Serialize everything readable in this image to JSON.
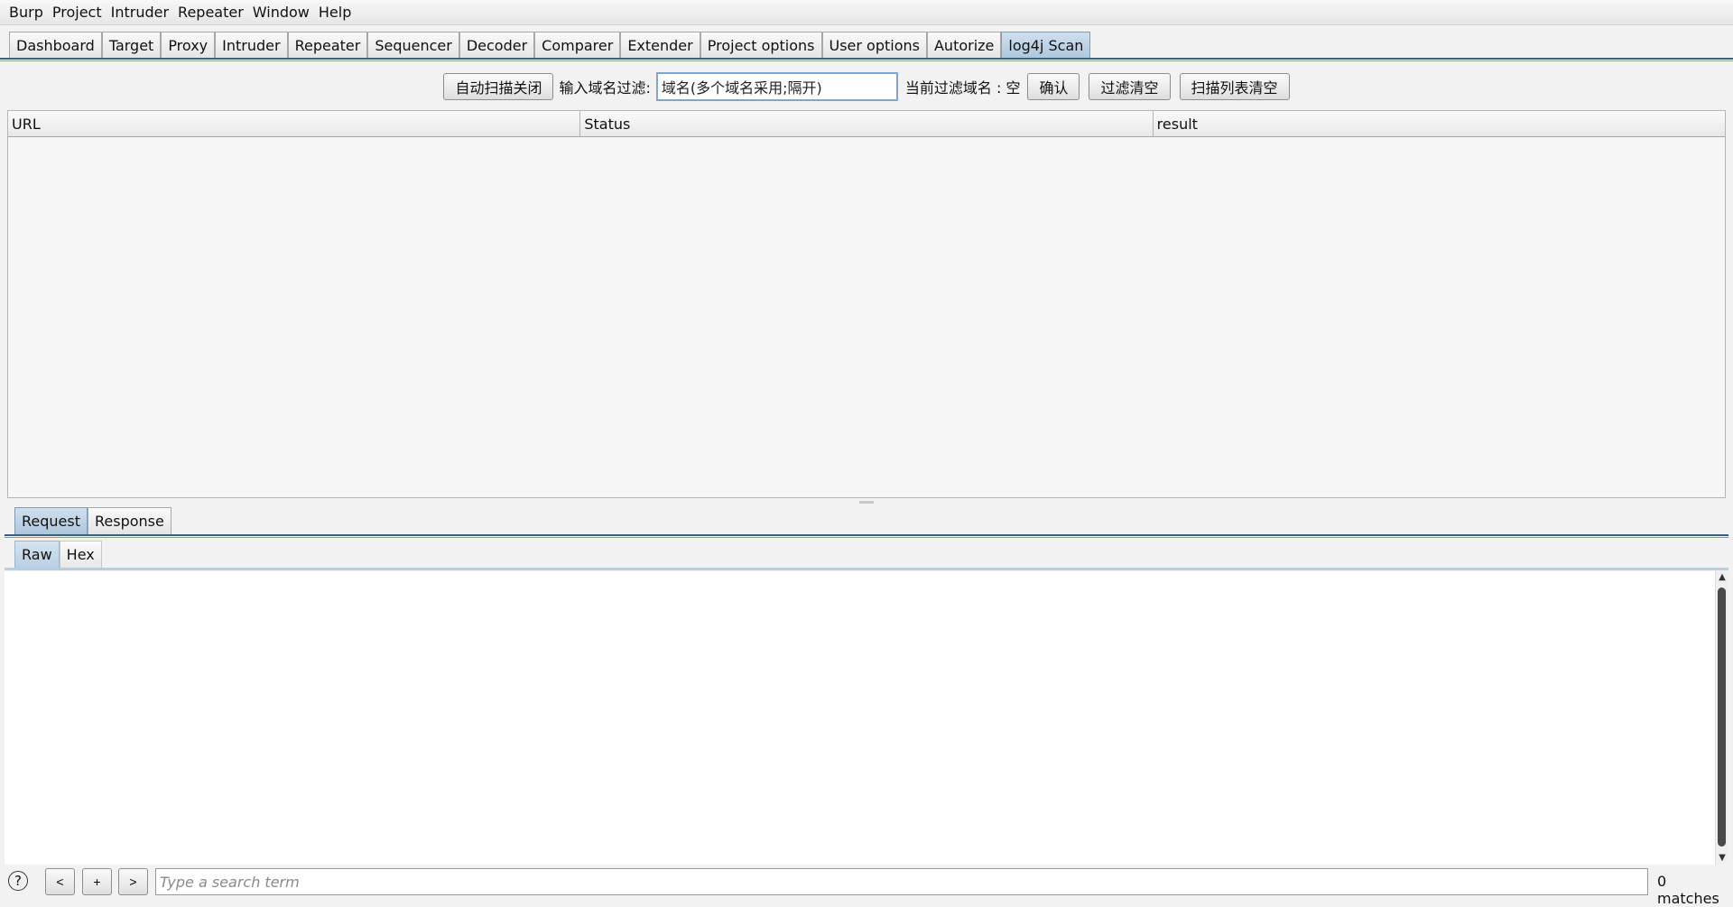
{
  "menu": [
    "Burp",
    "Project",
    "Intruder",
    "Repeater",
    "Window",
    "Help"
  ],
  "tabs": [
    "Dashboard",
    "Target",
    "Proxy",
    "Intruder",
    "Repeater",
    "Sequencer",
    "Decoder",
    "Comparer",
    "Extender",
    "Project options",
    "User options",
    "Autorize",
    "log4j Scan"
  ],
  "active_tab": "log4j Scan",
  "toolbar": {
    "auto_scan_button": "自动扫描关闭",
    "filter_label": "输入域名过滤:",
    "filter_value": "域名(多个域名采用;隔开)",
    "current_filter_label": "当前过滤域名 : 空",
    "confirm_button": "确认",
    "clear_filter_button": "过滤清空",
    "clear_list_button": "扫描列表清空"
  },
  "table": {
    "columns": [
      "URL",
      "Status",
      "result"
    ],
    "rows": []
  },
  "message_tabs": [
    "Request",
    "Response"
  ],
  "active_message_tab": "Request",
  "view_tabs": [
    "Raw",
    "Hex"
  ],
  "active_view_tab": "Raw",
  "search": {
    "help": "?",
    "prev": "<",
    "add": "+",
    "next": ">",
    "placeholder": "Type a search term",
    "matches": "0 matches"
  }
}
